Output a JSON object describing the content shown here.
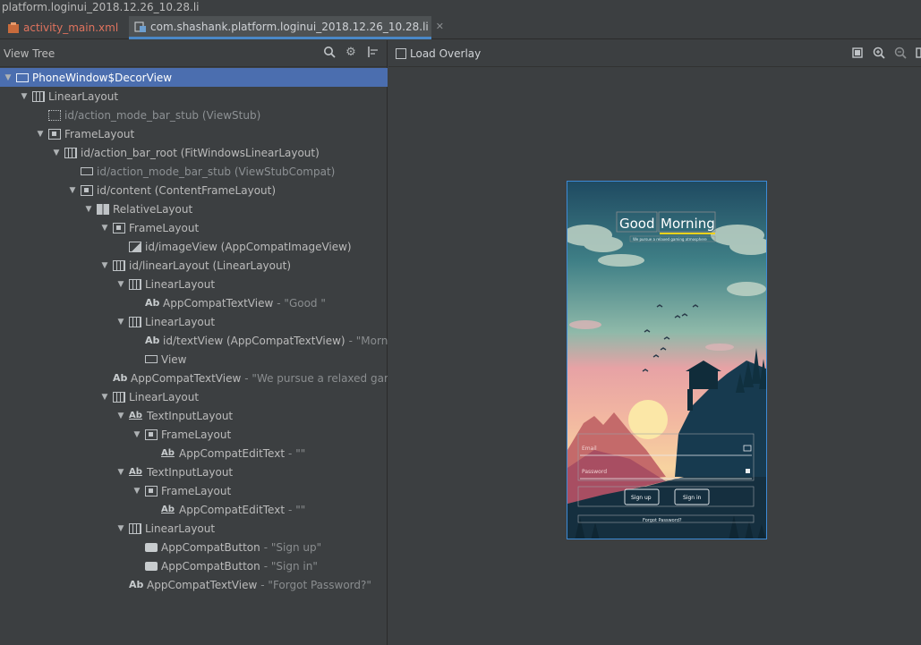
{
  "window": {
    "title_fragment": "platform.loginui_2018.12.26_10.28.li"
  },
  "tabs": [
    {
      "label": "activity_main.xml",
      "active": false
    },
    {
      "label": "com.shashank.platform.loginui_2018.12.26_10.28.li",
      "active": true
    }
  ],
  "view_tree": {
    "title": "View Tree",
    "icons": [
      "search-icon",
      "settings-icon",
      "layout-bounds-icon"
    ],
    "nodes": [
      {
        "depth": 0,
        "arrow": "open",
        "icon": "window",
        "text": "PhoneWindow$DecorView",
        "value": "",
        "selected": true
      },
      {
        "depth": 1,
        "arrow": "open",
        "icon": "linear",
        "text": "LinearLayout",
        "value": ""
      },
      {
        "depth": 2,
        "arrow": "none",
        "icon": "stub",
        "text": "id/action_mode_bar_stub (ViewStub)",
        "value": "",
        "dim": true
      },
      {
        "depth": 2,
        "arrow": "open",
        "icon": "frame",
        "text": "FrameLayout",
        "value": ""
      },
      {
        "depth": 3,
        "arrow": "open",
        "icon": "linear",
        "text": "id/action_bar_root (FitWindowsLinearLayout)",
        "value": ""
      },
      {
        "depth": 4,
        "arrow": "none",
        "icon": "rect",
        "text": "id/action_mode_bar_stub (ViewStubCompat)",
        "value": "",
        "dim": true
      },
      {
        "depth": 4,
        "arrow": "open",
        "icon": "frame",
        "text": "id/content (ContentFrameLayout)",
        "value": ""
      },
      {
        "depth": 5,
        "arrow": "open",
        "icon": "rel",
        "text": "RelativeLayout",
        "value": ""
      },
      {
        "depth": 6,
        "arrow": "open",
        "icon": "frame",
        "text": "FrameLayout",
        "value": ""
      },
      {
        "depth": 7,
        "arrow": "none",
        "icon": "img",
        "text": "id/imageView (AppCompatImageView)",
        "value": ""
      },
      {
        "depth": 6,
        "arrow": "open",
        "icon": "linear",
        "text": "id/linearLayout (LinearLayout)",
        "value": ""
      },
      {
        "depth": 7,
        "arrow": "open",
        "icon": "linear",
        "text": "LinearLayout",
        "value": ""
      },
      {
        "depth": 8,
        "arrow": "none",
        "icon": "ab",
        "text": "AppCompatTextView",
        "value": "- \"Good \""
      },
      {
        "depth": 7,
        "arrow": "open",
        "icon": "linear",
        "text": "LinearLayout",
        "value": ""
      },
      {
        "depth": 8,
        "arrow": "none",
        "icon": "ab",
        "text": "id/textView (AppCompatTextView)",
        "value": "- \"Morni"
      },
      {
        "depth": 8,
        "arrow": "none",
        "icon": "rect",
        "text": "View",
        "value": ""
      },
      {
        "depth": 6,
        "arrow": "none",
        "icon": "ab",
        "text": "AppCompatTextView",
        "value": "- \"We pursue a relaxed gam"
      },
      {
        "depth": 6,
        "arrow": "open",
        "icon": "linear",
        "text": "LinearLayout",
        "value": ""
      },
      {
        "depth": 7,
        "arrow": "open",
        "icon": "abu",
        "text": "TextInputLayout",
        "value": ""
      },
      {
        "depth": 8,
        "arrow": "open",
        "icon": "frame",
        "text": "FrameLayout",
        "value": ""
      },
      {
        "depth": 9,
        "arrow": "none",
        "icon": "abu",
        "text": "AppCompatEditText",
        "value": "- \"\""
      },
      {
        "depth": 7,
        "arrow": "open",
        "icon": "abu",
        "text": "TextInputLayout",
        "value": ""
      },
      {
        "depth": 8,
        "arrow": "open",
        "icon": "frame",
        "text": "FrameLayout",
        "value": ""
      },
      {
        "depth": 9,
        "arrow": "none",
        "icon": "abu",
        "text": "AppCompatEditText",
        "value": "- \"\""
      },
      {
        "depth": 7,
        "arrow": "open",
        "icon": "linear",
        "text": "LinearLayout",
        "value": ""
      },
      {
        "depth": 8,
        "arrow": "none",
        "icon": "btn",
        "text": "AppCompatButton",
        "value": "- \"Sign up\""
      },
      {
        "depth": 8,
        "arrow": "none",
        "icon": "btn",
        "text": "AppCompatButton",
        "value": "- \"Sign in\""
      },
      {
        "depth": 7,
        "arrow": "none",
        "icon": "ab",
        "text": "AppCompatTextView",
        "value": "- \"Forgot Password?\""
      }
    ]
  },
  "preview": {
    "toolbar_label": "Load Overlay",
    "toolbar_icons": [
      "fit-screen-icon",
      "zoom-in-icon",
      "zoom-out-icon"
    ],
    "screen": {
      "greeting_good": "Good",
      "greeting_morning": "Morning",
      "tagline": "We pursue a relaxed gaming atmosphere",
      "email_placeholder": "Email",
      "password_placeholder": "Password",
      "sign_up": "Sign up",
      "sign_in": "Sign in",
      "forgot": "Forgot Password?"
    },
    "colors": {
      "sky_top": "#1f4f66",
      "sky_mid": "#6fa6a3",
      "sky_pink": "#e89aa0",
      "sun": "#fbe7a7",
      "ground": "#173a4f",
      "selection": "#4b6eaf"
    }
  }
}
